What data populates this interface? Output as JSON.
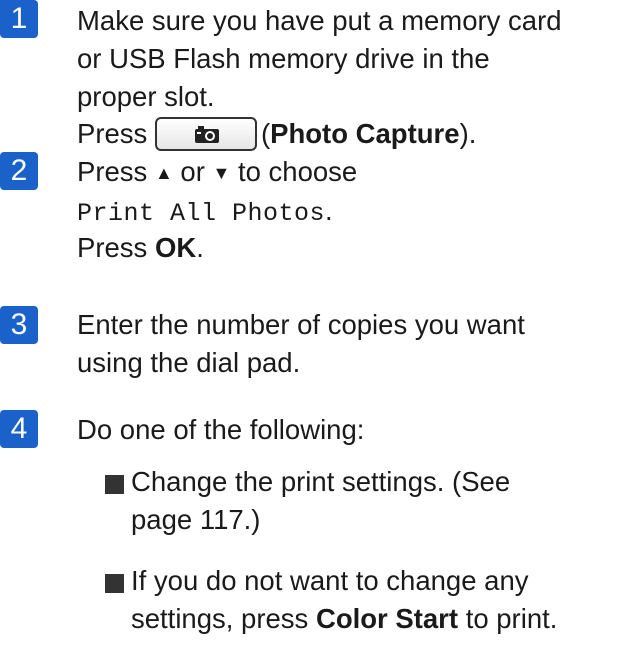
{
  "steps": [
    {
      "number": "1",
      "lines": [
        "Make sure you have put a memory card",
        "or USB Flash memory drive in the",
        "proper slot."
      ],
      "press_prefix": "Press",
      "button_icon": "camera-icon",
      "button_label_open": "(",
      "button_label_bold": "Photo Capture",
      "button_label_close": ")."
    },
    {
      "number": "2",
      "choose_text_a": "Press",
      "up_arrow": "▲",
      "or_text": "or",
      "down_arrow": "▼",
      "choose_text_b": "to choose",
      "menu_item": "Print All Photos",
      "menu_item_suffix": ".",
      "press_ok_prefix": "Press",
      "press_ok_bold": "OK",
      "press_ok_suffix": "."
    },
    {
      "number": "3",
      "lines": [
        "Enter the number of copies you want",
        "using the dial pad."
      ]
    },
    {
      "number": "4",
      "intro": "Do one of the following:",
      "bullets": [
        {
          "line1": "Change the print settings. (See",
          "line2": "page 117.)"
        },
        {
          "line1": "If you do not want to change any",
          "line2_prefix": "settings, press",
          "line2_bold": "Color Start",
          "line2_suffix": "to print."
        }
      ]
    }
  ],
  "colors": {
    "step_badge": "#1a62c9",
    "text": "#1a1a1a",
    "bullet": "#333333"
  }
}
